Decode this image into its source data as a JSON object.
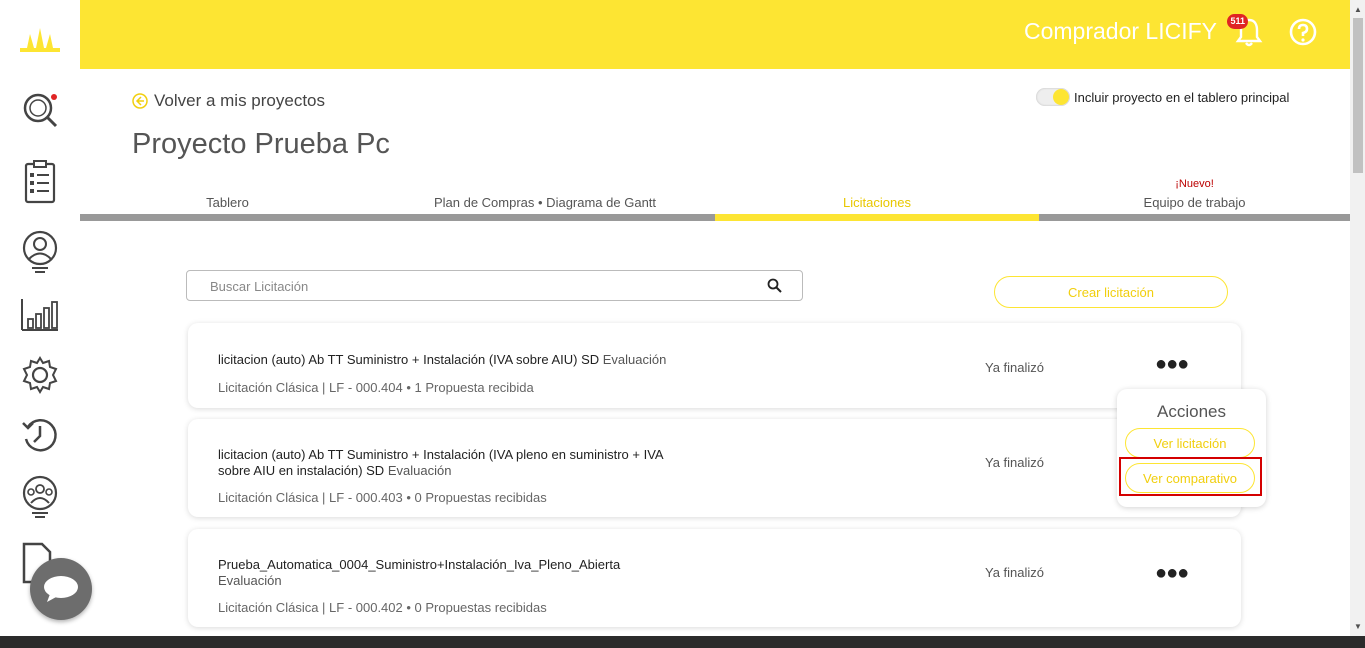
{
  "header": {
    "user_name": "Comprador LICIFY",
    "notification_count": "511"
  },
  "project": {
    "back_label": "Volver a mis proyectos",
    "title": "Proyecto Prueba Pc",
    "toggle_label": "Incluir proyecto en el tablero principal"
  },
  "tabs": [
    {
      "label": "Tablero"
    },
    {
      "label": "Plan de Compras • Diagrama de Gantt"
    },
    {
      "label": "Licitaciones"
    },
    {
      "label": "Equipo de trabajo",
      "badge": "¡Nuevo!"
    }
  ],
  "search": {
    "placeholder": "Buscar Licitación"
  },
  "create_label": "Crear licitación",
  "tenders": [
    {
      "name": "licitacion (auto) Ab TT Suministro + Instalación (IVA sobre AIU) SD",
      "stage": "Evaluación",
      "meta": "Licitación Clásica | LF - 000.404 • 1 Propuesta recibida",
      "status": "Ya finalizó"
    },
    {
      "name": "licitacion (auto) Ab TT Suministro + Instalación (IVA pleno en suministro + IVA sobre AIU en instalación) SD",
      "stage": "Evaluación",
      "meta": "Licitación Clásica | LF - 000.403 • 0 Propuestas recibidas",
      "status": "Ya finalizó"
    },
    {
      "name": "Prueba_Automatica_0004_Suministro+Instalación_Iva_Pleno_Abierta",
      "stage": "Evaluación",
      "meta": "Licitación Clásica | LF - 000.402 • 0 Propuestas recibidas",
      "status": "Ya finalizó"
    }
  ],
  "actions": {
    "title": "Acciones",
    "view_tender": "Ver licitación",
    "view_comparison": "Ver comparativo"
  },
  "colors": {
    "brand_yellow": "#fde533",
    "accent_text": "#f1cf0e",
    "highlight_red": "#d40000"
  }
}
